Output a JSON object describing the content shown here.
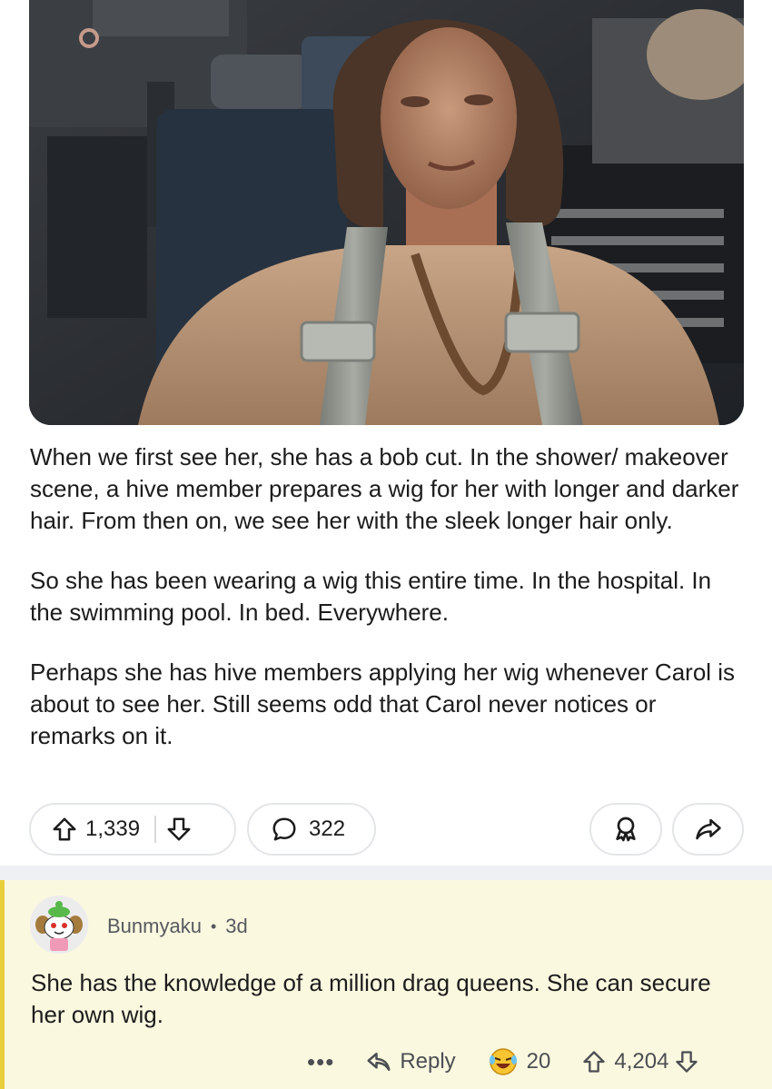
{
  "post": {
    "paragraphs": [
      "When we first see her, she has a bob cut. In the shower/ makeover scene, a hive member prepares a wig for her with longer and darker hair. From then on, we see her with the sleek longer hair only.",
      "So she has been wearing a wig this entire time. In the hospital. In the swimming pool. In bed. Everywhere.",
      "Perhaps she has hive members applying her wig whenever Carol is about to see her. Still seems odd that Carol never notices or remarks on it."
    ],
    "actions": {
      "upvote_icon": "arrow-up-icon",
      "downvote_icon": "arrow-down-icon",
      "score": "1,339",
      "comment_icon": "speech-bubble-icon",
      "comments": "322",
      "award_icon": "award-ribbon-icon",
      "share_icon": "share-arrow-icon"
    }
  },
  "comment": {
    "author": "Bunmyaku",
    "separator": "•",
    "age": "3d",
    "text": "She has the knowledge of a million drag queens. She can secure her own wig.",
    "actions": {
      "more": "•••",
      "reply_label": "Reply",
      "award_emoji_icon": "laughing-emoji-award-icon",
      "award_count": "20",
      "score": "4,204"
    }
  },
  "colors": {
    "comment_highlight": "#fbf8e0",
    "comment_rail": "#e9cf3b",
    "pill_border": "#e3e5e8",
    "separator": "#eef0f3"
  }
}
